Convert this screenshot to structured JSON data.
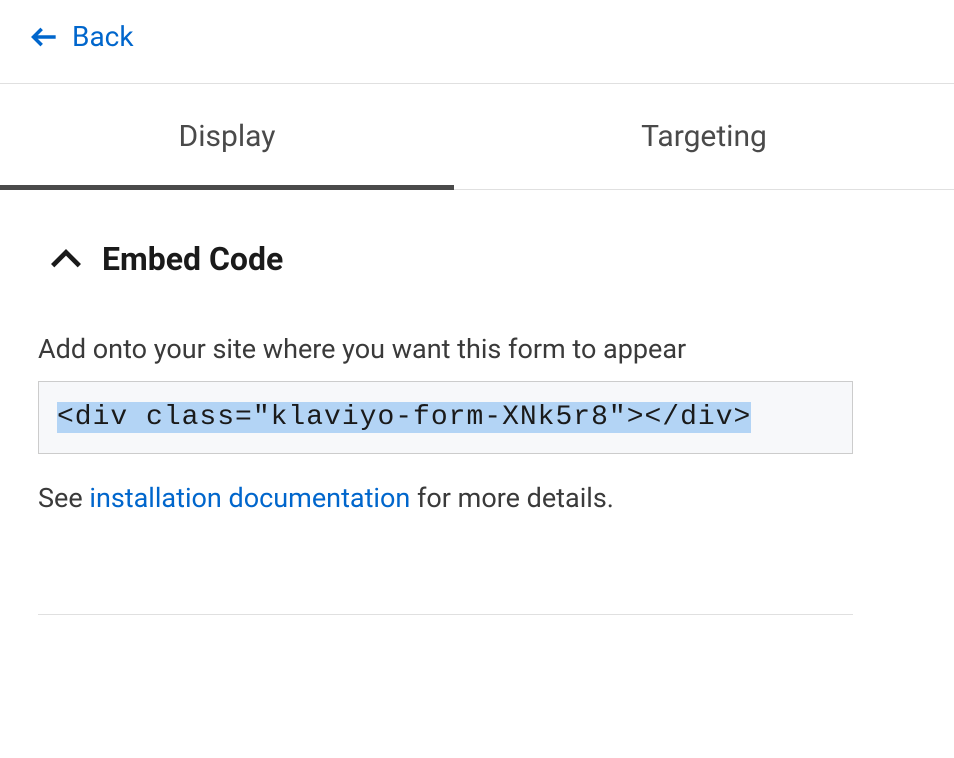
{
  "navigation": {
    "back_label": "Back"
  },
  "tabs": {
    "display": "Display",
    "targeting": "Targeting"
  },
  "section": {
    "title": "Embed Code",
    "instruction": "Add onto your site where you want this form to appear",
    "code": "<div class=\"klaviyo-form-XNk5r8\"></div>",
    "help_prefix": "See ",
    "help_link": "installation documentation",
    "help_suffix": " for more details."
  }
}
